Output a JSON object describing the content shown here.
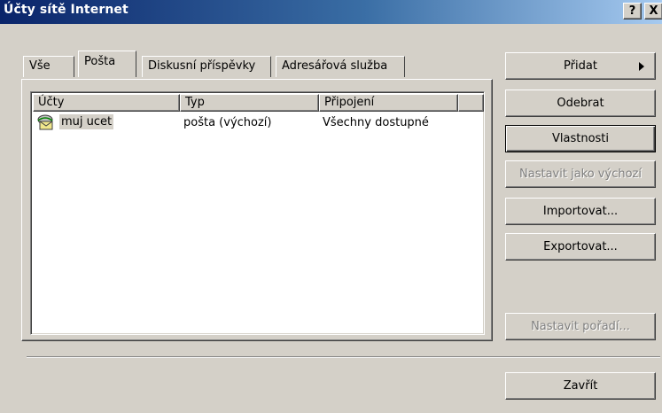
{
  "window": {
    "title": "Účty sítě Internet",
    "help_label": "?",
    "close_label": "X"
  },
  "tabs": [
    {
      "label": "Vše"
    },
    {
      "label": "Pošta"
    },
    {
      "label": "Diskusní příspěvky"
    },
    {
      "label": "Adresářová služba"
    }
  ],
  "list": {
    "columns": [
      "Účty",
      "Typ",
      "Připojení",
      ""
    ],
    "rows": [
      {
        "account": "muj ucet",
        "type": "pošta (výchozí)",
        "connection": "Všechny dostupné"
      }
    ]
  },
  "buttons": {
    "add": "Přidat",
    "remove": "Odebrat",
    "properties": "Vlastnosti",
    "set_default": "Nastavit jako výchozí",
    "import": "Importovat...",
    "export": "Exportovat...",
    "set_order": "Nastavit pořadí...",
    "close": "Zavřít"
  },
  "colors": {
    "title_gradient_start": "#0a246a",
    "title_gradient_end": "#a6caf0",
    "face": "#d4d0c8"
  },
  "icons": {
    "account": "mail-account-icon",
    "add_arrow": "chevron-right-icon"
  }
}
